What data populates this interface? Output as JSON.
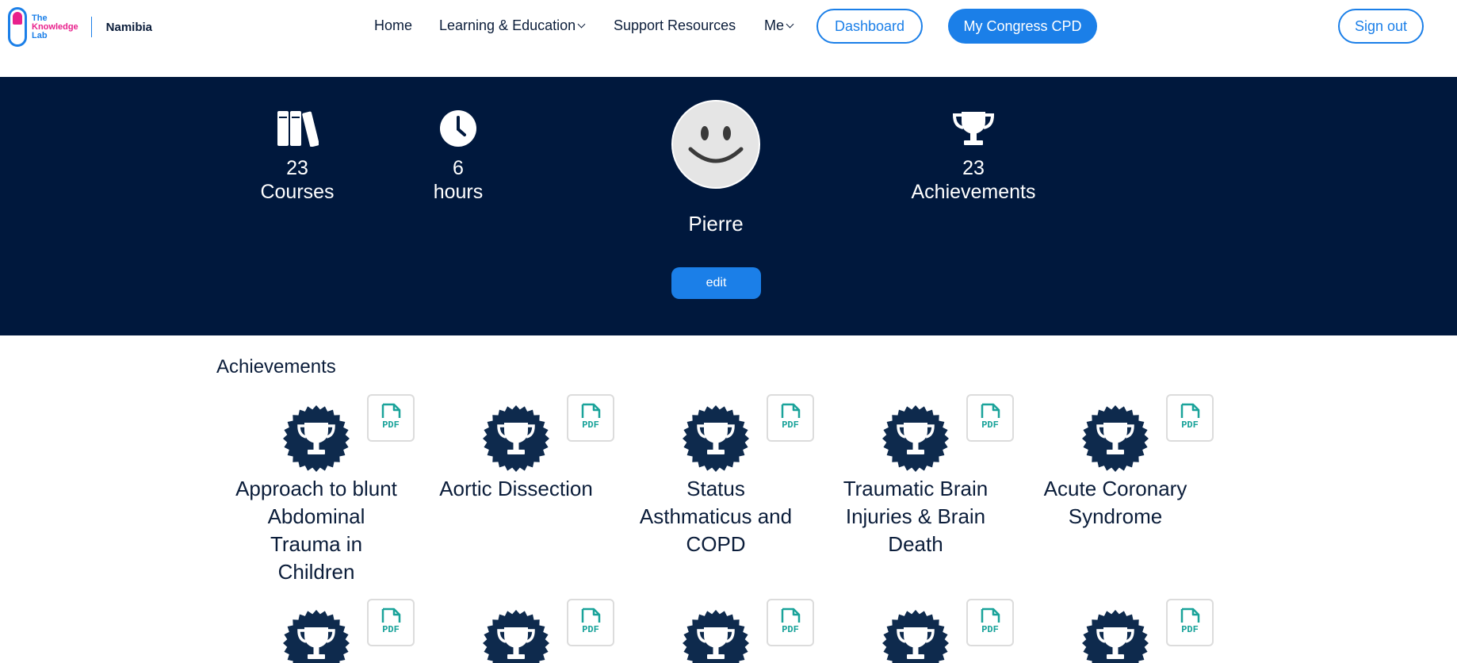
{
  "brand": {
    "line1": "The",
    "line2": "Knowledge",
    "line3": "Lab",
    "country": "Namibia"
  },
  "nav": {
    "home": "Home",
    "learning": "Learning & Education",
    "support": "Support Resources",
    "me": "Me",
    "dashboard": "Dashboard",
    "cpd": "My Congress CPD",
    "signout": "Sign out"
  },
  "profile": {
    "courses_count": "23",
    "courses_label": "Courses",
    "hours_count": "6",
    "hours_label": "hours",
    "achievements_count": "23",
    "achievements_label": "Achievements",
    "name": "Pierre",
    "edit_label": "edit"
  },
  "achievements": {
    "title": "Achievements",
    "pdf_label": "PDF",
    "items": [
      {
        "title": "Approach to blunt Abdominal Trauma in Children"
      },
      {
        "title": "Aortic Dissection"
      },
      {
        "title": "Status Asthmaticus and COPD"
      },
      {
        "title": "Traumatic Brain Injuries & Brain Death"
      },
      {
        "title": "Acute Coronary Syndrome"
      }
    ]
  },
  "colors": {
    "navy": "#00183d",
    "accent": "#1b7fe8",
    "brand_pink": "#e8208c",
    "pdf_teal": "#1aa39a"
  }
}
